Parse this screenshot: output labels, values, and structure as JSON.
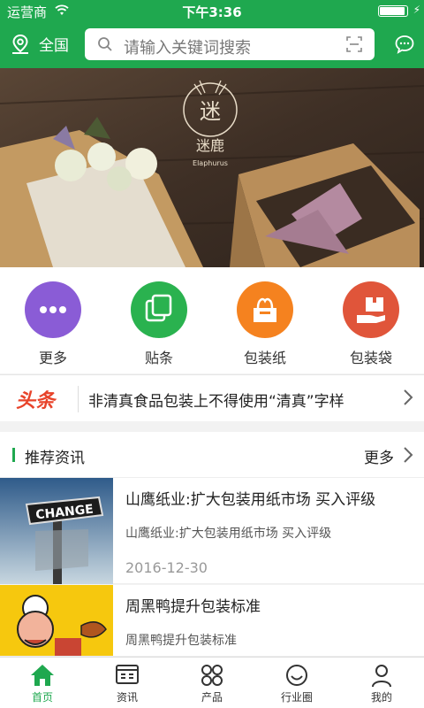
{
  "status_bar": {
    "carrier": "运营商",
    "time": "下午3:36"
  },
  "header": {
    "region": "全国",
    "search_placeholder": "请输入关键词搜索"
  },
  "banner": {
    "brand": "迷鹿",
    "brand_sub": "Elaphurus"
  },
  "categories": [
    {
      "label": "更多",
      "color": "#8a5cd6",
      "icon": "more-icon"
    },
    {
      "label": "贴条",
      "color": "#2ab24f",
      "icon": "copy-icon"
    },
    {
      "label": "包装纸",
      "color": "#f5821f",
      "icon": "tissue-box-icon"
    },
    {
      "label": "包装袋",
      "color": "#e0553a",
      "icon": "package-hand-icon"
    }
  ],
  "headline": {
    "tag": "头条",
    "text": "非清真食品包装上不得使用“清真”字样"
  },
  "recommend": {
    "title": "推荐资讯",
    "more": "更多"
  },
  "news": [
    {
      "title": "山鹰纸业:扩大包装用纸市场 买入评级",
      "summary": "山鹰纸业:扩大包装用纸市场 买入评级",
      "date": "2016-12-30",
      "thumb_text": "CHANGE"
    },
    {
      "title": "周黑鸭提升包装标准",
      "summary": "周黑鸭提升包装标准",
      "date": ""
    }
  ],
  "tabs": [
    {
      "label": "首页",
      "icon": "home-icon",
      "active": true
    },
    {
      "label": "资讯",
      "icon": "news-icon",
      "active": false
    },
    {
      "label": "产品",
      "icon": "grid-icon",
      "active": false
    },
    {
      "label": "行业圈",
      "icon": "smile-circle-icon",
      "active": false
    },
    {
      "label": "我的",
      "icon": "user-icon",
      "active": false
    }
  ],
  "colors": {
    "brand_green": "#1fa84f",
    "headline_red": "#e8432a"
  }
}
